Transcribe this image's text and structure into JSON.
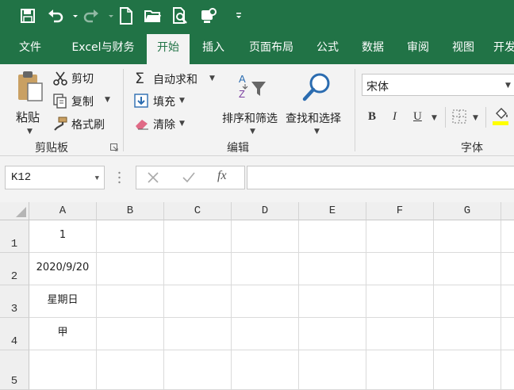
{
  "quick_access": {
    "icons": [
      "save-icon",
      "undo-icon",
      "redo-icon",
      "new-file-icon",
      "open-folder-icon",
      "print-preview-icon",
      "touch-mode-icon",
      "customize-icon"
    ]
  },
  "tabs": [
    {
      "label": "文件"
    },
    {
      "label": "Excel与财务"
    },
    {
      "label": "开始",
      "active": true
    },
    {
      "label": "插入"
    },
    {
      "label": "页面布局"
    },
    {
      "label": "公式"
    },
    {
      "label": "数据"
    },
    {
      "label": "审阅"
    },
    {
      "label": "视图"
    },
    {
      "label": "开发"
    }
  ],
  "ribbon": {
    "clipboard": {
      "paste_label": "粘贴",
      "cut_label": "剪切",
      "copy_label": "复制",
      "format_painter_label": "格式刷",
      "group_label": "剪贴板"
    },
    "editing": {
      "autosum_label": "自动求和",
      "fill_label": "填充",
      "clear_label": "清除",
      "sort_filter_label": "排序和筛选",
      "find_select_label": "查找和选择",
      "group_label": "编辑"
    },
    "font": {
      "font_name": "宋体",
      "bold": "B",
      "italic": "I",
      "underline": "U",
      "group_label": "字体",
      "fill_color": "#ffff00"
    }
  },
  "formula_bar": {
    "name_box": "K12",
    "formula": "",
    "fx_label": "fx"
  },
  "sheet": {
    "columns": [
      "A",
      "B",
      "C",
      "D",
      "E",
      "F",
      "G"
    ],
    "rows": [
      "1",
      "2",
      "3",
      "4",
      "5"
    ],
    "cells": {
      "A1": "1",
      "A2": "2020/9/20",
      "A3": "星期日",
      "A4": "甲"
    }
  },
  "colors": {
    "brand_green": "#217346"
  }
}
